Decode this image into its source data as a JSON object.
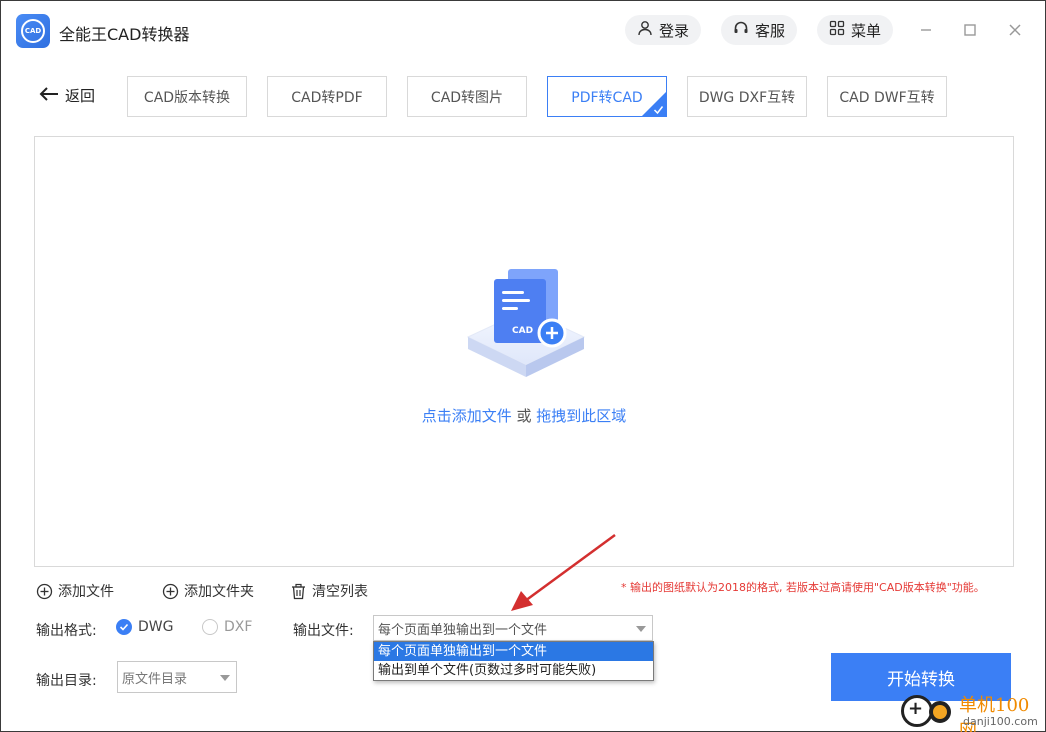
{
  "app": {
    "title": "全能王CAD转换器",
    "logo_text": "CAD"
  },
  "header": {
    "login_label": "登录",
    "service_label": "客服",
    "menu_label": "菜单"
  },
  "nav": {
    "back_label": "返回",
    "tabs": [
      {
        "label": "CAD版本转换",
        "active": false
      },
      {
        "label": "CAD转PDF",
        "active": false
      },
      {
        "label": "CAD转图片",
        "active": false
      },
      {
        "label": "PDF转CAD",
        "active": true
      },
      {
        "label": "DWG DXF互转",
        "active": false
      },
      {
        "label": "CAD DWF互转",
        "active": false
      }
    ]
  },
  "dropzone": {
    "icon_label": "CAD",
    "add_text": "点击添加文件",
    "or_text": " 或 ",
    "drag_text": "拖拽到此区域"
  },
  "tools": {
    "add_file": "添加文件",
    "add_folder": "添加文件夹",
    "clear_list": "清空列表",
    "note": "* 输出的图纸默认为2018的格式, 若版本过高请使用\"CAD版本转换\"功能。"
  },
  "output": {
    "format_label": "输出格式:",
    "formats": [
      {
        "label": "DWG",
        "selected": true
      },
      {
        "label": "DXF",
        "selected": false
      }
    ],
    "file_label": "输出文件:",
    "file_value": "每个页面单独输出到一个文件",
    "file_options": [
      {
        "label": "每个页面单独输出到一个文件",
        "selected": true
      },
      {
        "label": "输出到单个文件(页数过多时可能失败)",
        "selected": false
      }
    ],
    "dir_label": "输出目录:",
    "dir_value": "原文件目录"
  },
  "actions": {
    "start_label": "开始转换"
  },
  "watermark": {
    "brand": "单机100网",
    "site": "danji100.com"
  },
  "colors": {
    "accent": "#3b7ff5",
    "note": "#e53935",
    "annotation_arrow": "#d32f2f"
  }
}
